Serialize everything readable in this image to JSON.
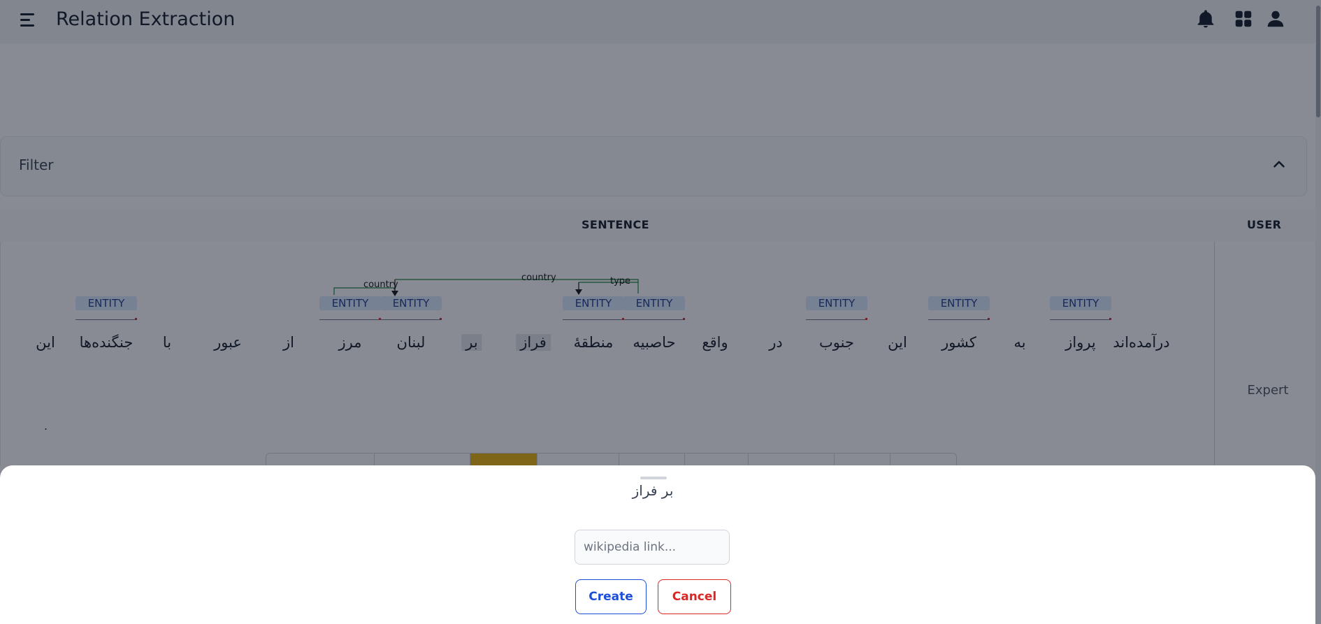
{
  "app": {
    "title": "Relation Extraction"
  },
  "header_icons": [
    "menu-icon",
    "bell-icon",
    "apps-grid-icon",
    "user-icon"
  ],
  "filter": {
    "label": "Filter"
  },
  "table": {
    "headers": {
      "sentence": "SENTENCE",
      "user": "USER"
    },
    "user_value": "Expert",
    "tokens": [
      "درآمده‌اند",
      "پرواز",
      "به",
      "کشور",
      "این",
      "جنوب",
      "در",
      "واقع",
      "حاصبیه",
      "منطقهٔ",
      "فراز",
      "بر",
      "لبنان",
      "مرز",
      "از",
      "عبور",
      "با",
      "جنگنده‌ها",
      "این"
    ],
    "end_mark": ".",
    "entity_label": "ENTITY",
    "relations": [
      "country",
      "country",
      "type"
    ]
  },
  "sheet": {
    "title": "بر فراز",
    "input_placeholder": "wikipedia link...",
    "input_value": "",
    "create_label": "Create",
    "cancel_label": "Cancel"
  },
  "colors": {
    "create": "#1d4ed8",
    "cancel": "#dc2626",
    "entity": "#dbeafe",
    "relation_line": "#15803d",
    "action_highlight": "#eab308"
  }
}
